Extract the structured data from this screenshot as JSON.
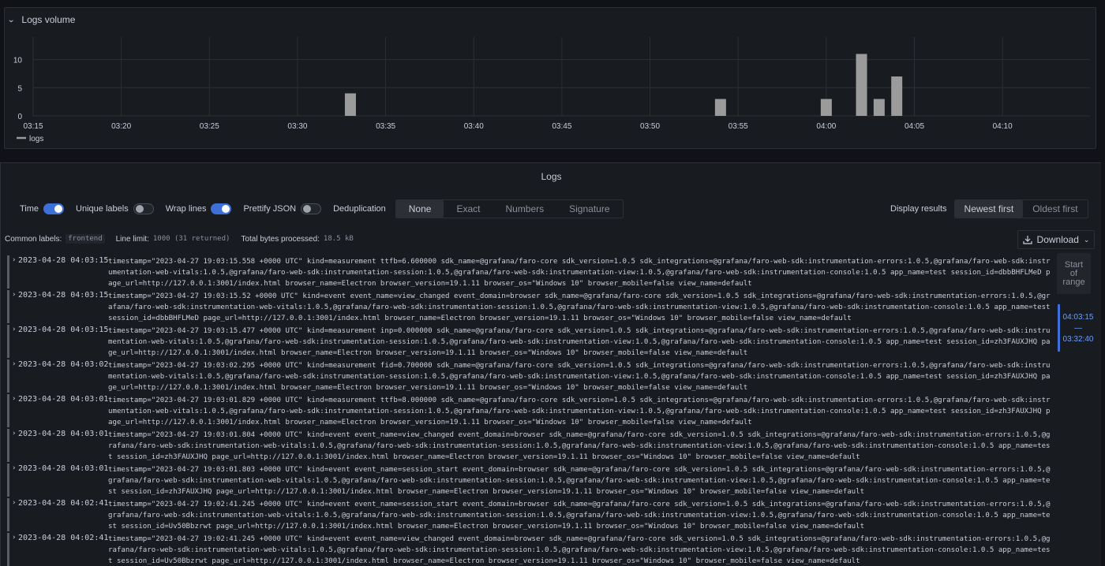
{
  "volume": {
    "title": "Logs volume",
    "legend": "logs",
    "colors": {
      "bar": "#9b9b9b",
      "grid": "#2c2f35",
      "axis": "#ccccdc"
    }
  },
  "chart_data": {
    "type": "bar",
    "title": "",
    "xlabel": "",
    "ylabel": "",
    "x_ticks": [
      "03:15",
      "03:20",
      "03:25",
      "03:30",
      "03:35",
      "03:40",
      "03:45",
      "03:50",
      "03:55",
      "04:00",
      "04:05",
      "04:10"
    ],
    "y_ticks": [
      0,
      5,
      10
    ],
    "ylim": [
      0,
      14
    ],
    "grid": true,
    "legend_position": "bottom-left",
    "series": [
      {
        "name": "logs",
        "points": [
          {
            "t": "03:33",
            "value": 4
          },
          {
            "t": "03:54",
            "value": 3
          },
          {
            "t": "04:00",
            "value": 3
          },
          {
            "t": "04:02",
            "value": 11
          },
          {
            "t": "04:03",
            "value": 3
          },
          {
            "t": "04:04",
            "value": 7
          }
        ]
      }
    ]
  },
  "logs": {
    "title": "Logs",
    "controls": {
      "time": "Time",
      "unique_labels": "Unique labels",
      "wrap_lines": "Wrap lines",
      "prettify_json": "Prettify JSON",
      "deduplication": "Deduplication",
      "dedup_options": [
        "None",
        "Exact",
        "Numbers",
        "Signature"
      ],
      "display_results": "Display results",
      "order_options": [
        "Newest first",
        "Oldest first"
      ]
    },
    "meta": {
      "common_labels": "Common labels:",
      "common_labels_value": "frontend",
      "line_limit": "Line limit:",
      "line_limit_value": "1000 (31 returned)",
      "bytes": "Total bytes processed:",
      "bytes_value": "18.5 kB"
    },
    "download": "Download",
    "rows": [
      {
        "time": "2023-04-28 04:03:15",
        "msg": "timestamp=\"2023-04-27 19:03:15.558 +0000 UTC\" kind=measurement ttfb=6.600000 sdk_name=@grafana/faro-core sdk_version=1.0.5 sdk_integrations=@grafana/faro-web-sdk:instrumentation-errors:1.0.5,@grafana/faro-web-sdk:instrumentation-web-vitals:1.0.5,@grafana/faro-web-sdk:instrumentation-session:1.0.5,@grafana/faro-web-sdk:instrumentation-view:1.0.5,@grafana/faro-web-sdk:instrumentation-console:1.0.5 app_name=test session_id=dbbBHFLMeD page_url=http://127.0.0.1:3001/index.html browser_name=Electron browser_version=19.1.11 browser_os=\"Windows 10\" browser_mobile=false view_name=default"
      },
      {
        "time": "2023-04-28 04:03:15",
        "msg": "timestamp=\"2023-04-27 19:03:15.52 +0000 UTC\" kind=event event_name=view_changed event_domain=browser sdk_name=@grafana/faro-core sdk_version=1.0.5 sdk_integrations=@grafana/faro-web-sdk:instrumentation-errors:1.0.5,@grafana/faro-web-sdk:instrumentation-web-vitals:1.0.5,@grafana/faro-web-sdk:instrumentation-session:1.0.5,@grafana/faro-web-sdk:instrumentation-view:1.0.5,@grafana/faro-web-sdk:instrumentation-console:1.0.5 app_name=test session_id=dbbBHFLMeD page_url=http://127.0.0.1:3001/index.html browser_name=Electron browser_version=19.1.11 browser_os=\"Windows 10\" browser_mobile=false view_name=default"
      },
      {
        "time": "2023-04-28 04:03:15",
        "msg": "timestamp=\"2023-04-27 19:03:15.477 +0000 UTC\" kind=measurement inp=0.000000 sdk_name=@grafana/faro-core sdk_version=1.0.5 sdk_integrations=@grafana/faro-web-sdk:instrumentation-errors:1.0.5,@grafana/faro-web-sdk:instrumentation-web-vitals:1.0.5,@grafana/faro-web-sdk:instrumentation-session:1.0.5,@grafana/faro-web-sdk:instrumentation-view:1.0.5,@grafana/faro-web-sdk:instrumentation-console:1.0.5 app_name=test session_id=zh3FAUXJHQ page_url=http://127.0.0.1:3001/index.html browser_name=Electron browser_version=19.1.11 browser_os=\"Windows 10\" browser_mobile=false view_name=default"
      },
      {
        "time": "2023-04-28 04:03:02",
        "msg": "timestamp=\"2023-04-27 19:03:02.295 +0000 UTC\" kind=measurement fid=0.700000 sdk_name=@grafana/faro-core sdk_version=1.0.5 sdk_integrations=@grafana/faro-web-sdk:instrumentation-errors:1.0.5,@grafana/faro-web-sdk:instrumentation-web-vitals:1.0.5,@grafana/faro-web-sdk:instrumentation-session:1.0.5,@grafana/faro-web-sdk:instrumentation-view:1.0.5,@grafana/faro-web-sdk:instrumentation-console:1.0.5 app_name=test session_id=zh3FAUXJHQ page_url=http://127.0.0.1:3001/index.html browser_name=Electron browser_version=19.1.11 browser_os=\"Windows 10\" browser_mobile=false view_name=default"
      },
      {
        "time": "2023-04-28 04:03:01",
        "msg": "timestamp=\"2023-04-27 19:03:01.829 +0000 UTC\" kind=measurement ttfb=8.000000 sdk_name=@grafana/faro-core sdk_version=1.0.5 sdk_integrations=@grafana/faro-web-sdk:instrumentation-errors:1.0.5,@grafana/faro-web-sdk:instrumentation-web-vitals:1.0.5,@grafana/faro-web-sdk:instrumentation-session:1.0.5,@grafana/faro-web-sdk:instrumentation-view:1.0.5,@grafana/faro-web-sdk:instrumentation-console:1.0.5 app_name=test session_id=zh3FAUXJHQ page_url=http://127.0.0.1:3001/index.html browser_name=Electron browser_version=19.1.11 browser_os=\"Windows 10\" browser_mobile=false view_name=default"
      },
      {
        "time": "2023-04-28 04:03:01",
        "msg": "timestamp=\"2023-04-27 19:03:01.804 +0000 UTC\" kind=event event_name=view_changed event_domain=browser sdk_name=@grafana/faro-core sdk_version=1.0.5 sdk_integrations=@grafana/faro-web-sdk:instrumentation-errors:1.0.5,@grafana/faro-web-sdk:instrumentation-web-vitals:1.0.5,@grafana/faro-web-sdk:instrumentation-session:1.0.5,@grafana/faro-web-sdk:instrumentation-view:1.0.5,@grafana/faro-web-sdk:instrumentation-console:1.0.5 app_name=test session_id=zh3FAUXJHQ page_url=http://127.0.0.1:3001/index.html browser_name=Electron browser_version=19.1.11 browser_os=\"Windows 10\" browser_mobile=false view_name=default"
      },
      {
        "time": "2023-04-28 04:03:01",
        "msg": "timestamp=\"2023-04-27 19:03:01.803 +0000 UTC\" kind=event event_name=session_start event_domain=browser sdk_name=@grafana/faro-core sdk_version=1.0.5 sdk_integrations=@grafana/faro-web-sdk:instrumentation-errors:1.0.5,@grafana/faro-web-sdk:instrumentation-web-vitals:1.0.5,@grafana/faro-web-sdk:instrumentation-session:1.0.5,@grafana/faro-web-sdk:instrumentation-view:1.0.5,@grafana/faro-web-sdk:instrumentation-console:1.0.5 app_name=test session_id=zh3FAUXJHQ page_url=http://127.0.0.1:3001/index.html browser_name=Electron browser_version=19.1.11 browser_os=\"Windows 10\" browser_mobile=false view_name=default"
      },
      {
        "time": "2023-04-28 04:02:41",
        "msg": "timestamp=\"2023-04-27 19:02:41.245 +0000 UTC\" kind=event event_name=session_start event_domain=browser sdk_name=@grafana/faro-core sdk_version=1.0.5 sdk_integrations=@grafana/faro-web-sdk:instrumentation-errors:1.0.5,@grafana/faro-web-sdk:instrumentation-web-vitals:1.0.5,@grafana/faro-web-sdk:instrumentation-session:1.0.5,@grafana/faro-web-sdk:instrumentation-view:1.0.5,@grafana/faro-web-sdk:instrumentation-console:1.0.5 app_name=test session_id=Uv50Bbzrwt page_url=http://127.0.0.1:3001/index.html browser_name=Electron browser_version=19.1.11 browser_os=\"Windows 10\" browser_mobile=false view_name=default"
      },
      {
        "time": "2023-04-28 04:02:41",
        "msg": "timestamp=\"2023-04-27 19:02:41.245 +0000 UTC\" kind=event event_name=view_changed event_domain=browser sdk_name=@grafana/faro-core sdk_version=1.0.5 sdk_integrations=@grafana/faro-web-sdk:instrumentation-errors:1.0.5,@grafana/faro-web-sdk:instrumentation-web-vitals:1.0.5,@grafana/faro-web-sdk:instrumentation-session:1.0.5,@grafana/faro-web-sdk:instrumentation-view:1.0.5,@grafana/faro-web-sdk:instrumentation-console:1.0.5 app_name=test session_id=Uv50Bbzrwt page_url=http://127.0.0.1:3001/index.html browser_name=Electron browser_version=19.1.11 browser_os=\"Windows 10\" browser_mobile=false view_name=default"
      }
    ]
  },
  "navigation": {
    "start_of_range": [
      "Start",
      "of",
      "range"
    ],
    "range_from": "04:03:15",
    "range_sep": "—",
    "range_to": "03:32:40"
  }
}
